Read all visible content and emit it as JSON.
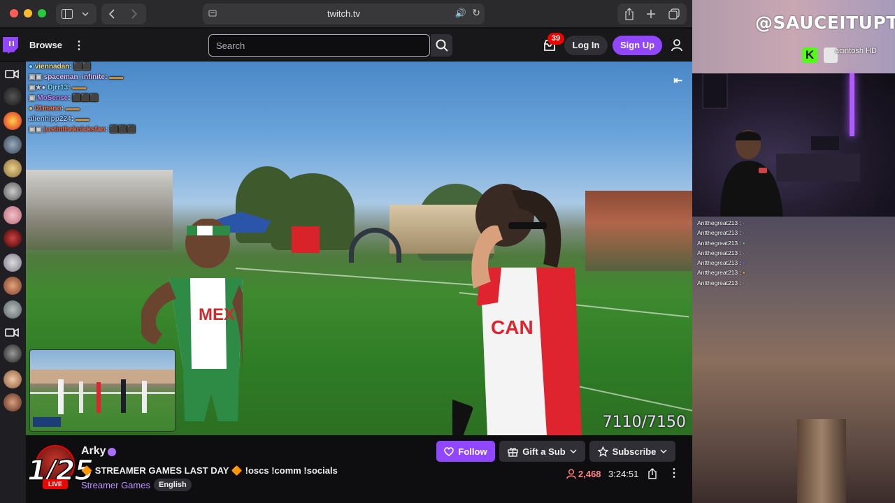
{
  "browser": {
    "url": "twitch.tv"
  },
  "nav": {
    "browse": "Browse",
    "search_placeholder": "Search",
    "inbox_count": "39",
    "login": "Log In",
    "signup": "Sign Up"
  },
  "video": {
    "chat": [
      {
        "user": "viennadan",
        "color": "#57c8f7"
      },
      {
        "user": "spaceman_infinite",
        "color": "#e0c3ff"
      },
      {
        "user": "Djrr13",
        "color": "#7fdcff"
      },
      {
        "user": "MoSense",
        "color": "#c08cff"
      },
      {
        "user": "01mano",
        "color": "#ff7a4d"
      },
      {
        "user": "alienhipp224",
        "color": "#9ec3ff"
      },
      {
        "user": "justintheknicksfan",
        "color": "#ff6b3d"
      }
    ],
    "counter": "7110/7150"
  },
  "channel": {
    "name": "Arky",
    "overlay_count": "1/25",
    "live": "LIVE",
    "title": "🔶 STREAMER GAMES LAST DAY 🔶 !oscs !comm !socials",
    "category": "Streamer Games",
    "tag": "English",
    "follow": "Follow",
    "gift": "Gift a Sub",
    "subscribe": "Subscribe",
    "viewers": "2,468",
    "uptime": "3:24:51"
  },
  "right": {
    "handle": "@SAUCEITUPTV",
    "kick_letter": "K",
    "drive_label": "acintosh HD",
    "chat_user": "Antthegreat213 :",
    "chat_rows": 7
  },
  "colors": {
    "accent": "#9147ff",
    "live": "#eb0400"
  }
}
